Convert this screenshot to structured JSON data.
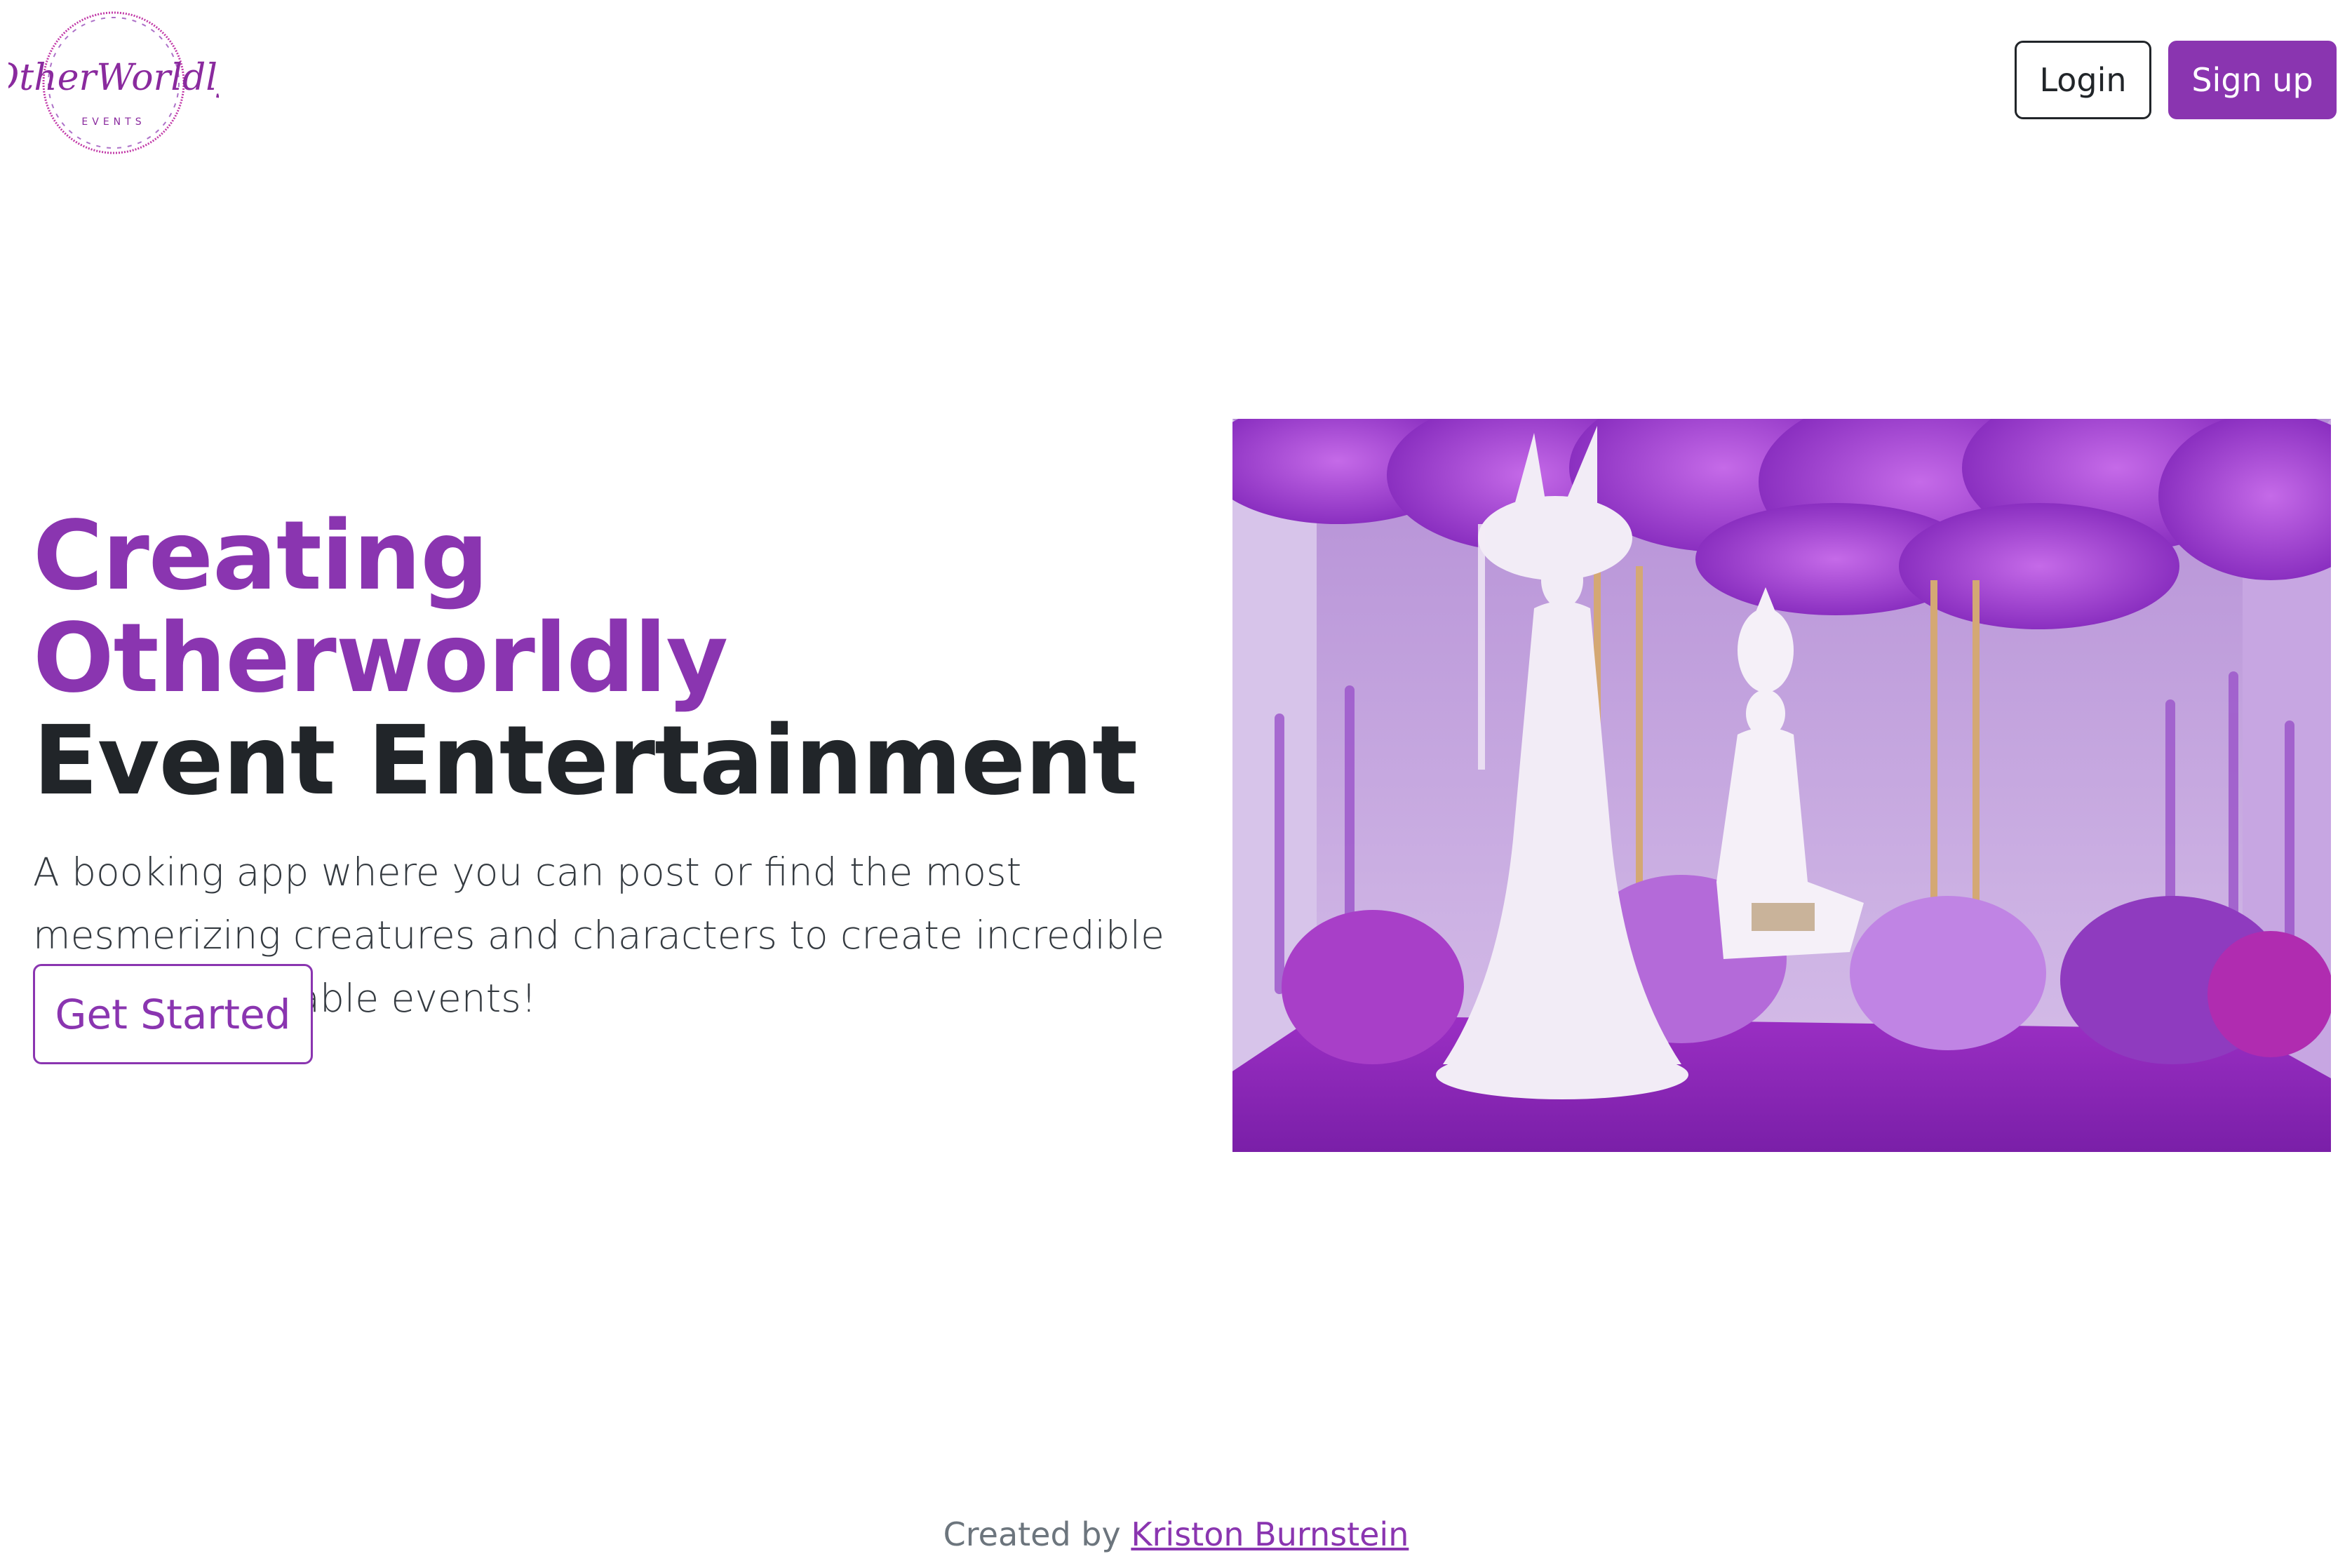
{
  "brand": {
    "logo_text": "OtherWorldly",
    "logo_subtext": "EVENTS",
    "accent_color": "#8a35b0"
  },
  "nav": {
    "login_label": "Login",
    "signup_label": "Sign up"
  },
  "hero": {
    "headline_line1": "Creating Otherworldly",
    "headline_line2": "Event Entertainment",
    "description": "A booking app where you can post or find the most mesmerizing creatures and characters to create incredible and unforgettable events!",
    "cta_label": "Get Started"
  },
  "footer": {
    "prefix": "Created by",
    "author": "Kriston Burnstein"
  }
}
